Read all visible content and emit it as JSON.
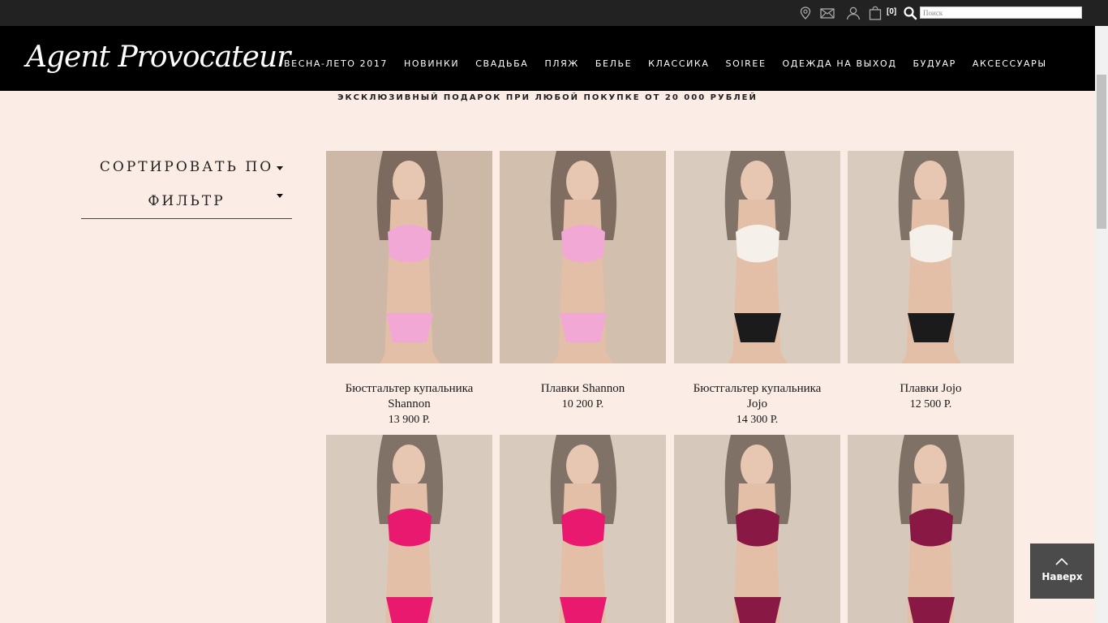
{
  "topbar": {
    "icons": [
      "location-pin-icon",
      "mail-icon",
      "user-icon",
      "shopping-bag-icon",
      "search-icon"
    ],
    "cart_count": "[0]",
    "search_placeholder": "Поиск"
  },
  "header": {
    "logo_text": "Agent Provocateur",
    "nav": [
      "ВЕСНА-ЛЕТО 2017",
      "НОВИНКИ",
      "СВАДЬБА",
      "ПЛЯЖ",
      "БЕЛЬЕ",
      "КЛАССИКА",
      "SOIREE",
      "ОДЕЖДА НА ВЫХОД",
      "БУДУАР",
      "АКСЕССУАРЫ"
    ]
  },
  "promo": "ЭКСКЛЮЗИВНЫЙ ПОДАРОК ПРИ ЛЮБОЙ ПОКУПКЕ ОТ 20 000 РУБЛЕЙ",
  "sidebar": {
    "sort_label": "СОРТИРОВАТЬ ПО",
    "filter_label": "ФИЛЬТР"
  },
  "products": [
    {
      "name": "Бюстгальтер купальника Shannon",
      "price": "13 900 Р.",
      "colors": {
        "top": "#f2a8d4",
        "bottom": "#f2a8d4",
        "bg": "#cdb8a7"
      }
    },
    {
      "name": "Плавки Shannon",
      "price": "10 200 Р.",
      "colors": {
        "top": "#f2a8d4",
        "bottom": "#f2a8d4",
        "bg": "#d2bfae"
      }
    },
    {
      "name": "Бюстгальтер купальника Jojo",
      "price": "14 300 Р.",
      "colors": {
        "top": "#f5f1ea",
        "bottom": "#1b1b1b",
        "bg": "#d9ccbe"
      }
    },
    {
      "name": "Плавки Jojo",
      "price": "12 500 Р.",
      "colors": {
        "top": "#f5f1ea",
        "bottom": "#1b1b1b",
        "bg": "#d9ccbe"
      }
    },
    {
      "name": "",
      "price": "",
      "colors": {
        "top": "#e8196f",
        "bottom": "#e8196f",
        "bg": "#d8cbbd"
      }
    },
    {
      "name": "",
      "price": "",
      "colors": {
        "top": "#e8196f",
        "bottom": "#e8196f",
        "bg": "#d8cbbd"
      }
    },
    {
      "name": "",
      "price": "",
      "colors": {
        "top": "#8a1845",
        "bottom": "#8a1845",
        "bg": "#d6c8ba"
      }
    },
    {
      "name": "",
      "price": "",
      "colors": {
        "top": "#8a1845",
        "bottom": "#8a1845",
        "bg": "#d6c8ba"
      }
    }
  ],
  "to_top_label": "Наверх",
  "colors": {
    "page_bg": "#fcece6",
    "header_bg": "#000000",
    "topbar_bg": "#222222"
  }
}
